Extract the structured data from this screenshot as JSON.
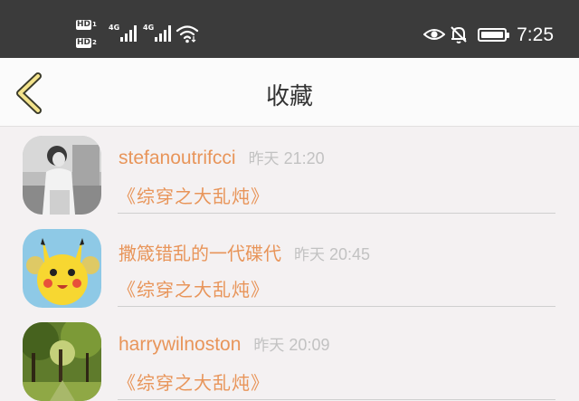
{
  "status_bar": {
    "hd1": "HD",
    "hd1_num": "1",
    "hd2": "HD",
    "hd2_num": "2",
    "signal1_label": "4G",
    "signal2_label": "4G",
    "time": "7:25",
    "icons": [
      "hd-icon",
      "signal-icon",
      "signal-icon",
      "wifi-icon",
      "eye-icon",
      "bell-off-icon",
      "battery-icon"
    ]
  },
  "nav": {
    "title": "收藏",
    "back_icon": "chevron-left-icon",
    "accent": "#e8955a"
  },
  "favorites": [
    {
      "user": "stefanoutrifcci",
      "day": "昨天",
      "time": "21:20",
      "book": "《综穿之大乱炖》",
      "avatar": "person-photo"
    },
    {
      "user": "撒箴错乱的一代碟代",
      "day": "昨天",
      "time": "20:45",
      "book": "《综穿之大乱炖》",
      "avatar": "pikachu-image"
    },
    {
      "user": "harrywilnoston",
      "day": "昨天",
      "time": "20:09",
      "book": "《综穿之大乱炖》",
      "avatar": "forest-photo"
    }
  ]
}
